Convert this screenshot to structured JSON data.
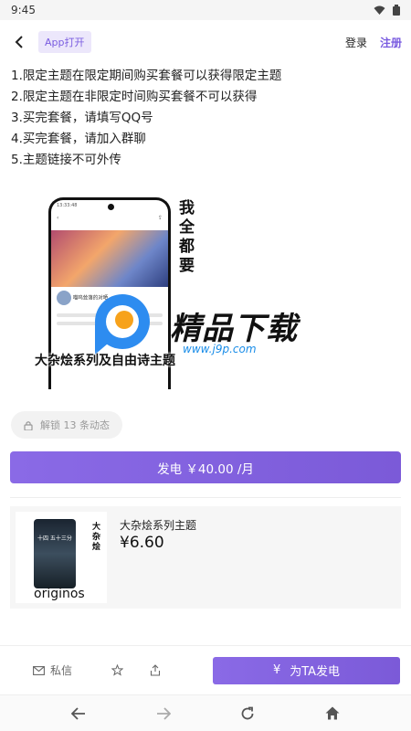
{
  "status_bar": {
    "time": "9:45"
  },
  "top_nav": {
    "app_open_label": "App打开",
    "login_label": "登录",
    "register_label": "注册"
  },
  "rules": [
    "1.限定主题在限定期间购买套餐可以获得限定主题",
    "2.限定主题在非限定时间购买套餐不可以获得",
    "3.买完套餐，请填写QQ号",
    "4.买完套餐，请加入群聊",
    "5.主题链接不可外传"
  ],
  "promo_image": {
    "side_text": "我全都要",
    "caption": "大杂烩系列及自由诗主题",
    "phone_time": "13:33:48",
    "phone_post_title": "喵呜耸落的对晒"
  },
  "watermark": {
    "text": "精品下载",
    "url": "www.j9p.com"
  },
  "unlock": {
    "label": "解锁 13 条动态"
  },
  "charge_button": {
    "label": "发电 ￥40.00 /月"
  },
  "product": {
    "name": "大杂烩系列主题",
    "price": "¥6.60",
    "thumb_side_text": "大杂烩",
    "thumb_time": "十四 五十三分",
    "thumb_os": "originos"
  },
  "bottom_bar": {
    "message_label": "私信",
    "charge_label": "为TA发电",
    "charge_symbol": "¥"
  },
  "colors": {
    "accent": "#7b5ad8",
    "accent_light": "#ece7fb"
  }
}
